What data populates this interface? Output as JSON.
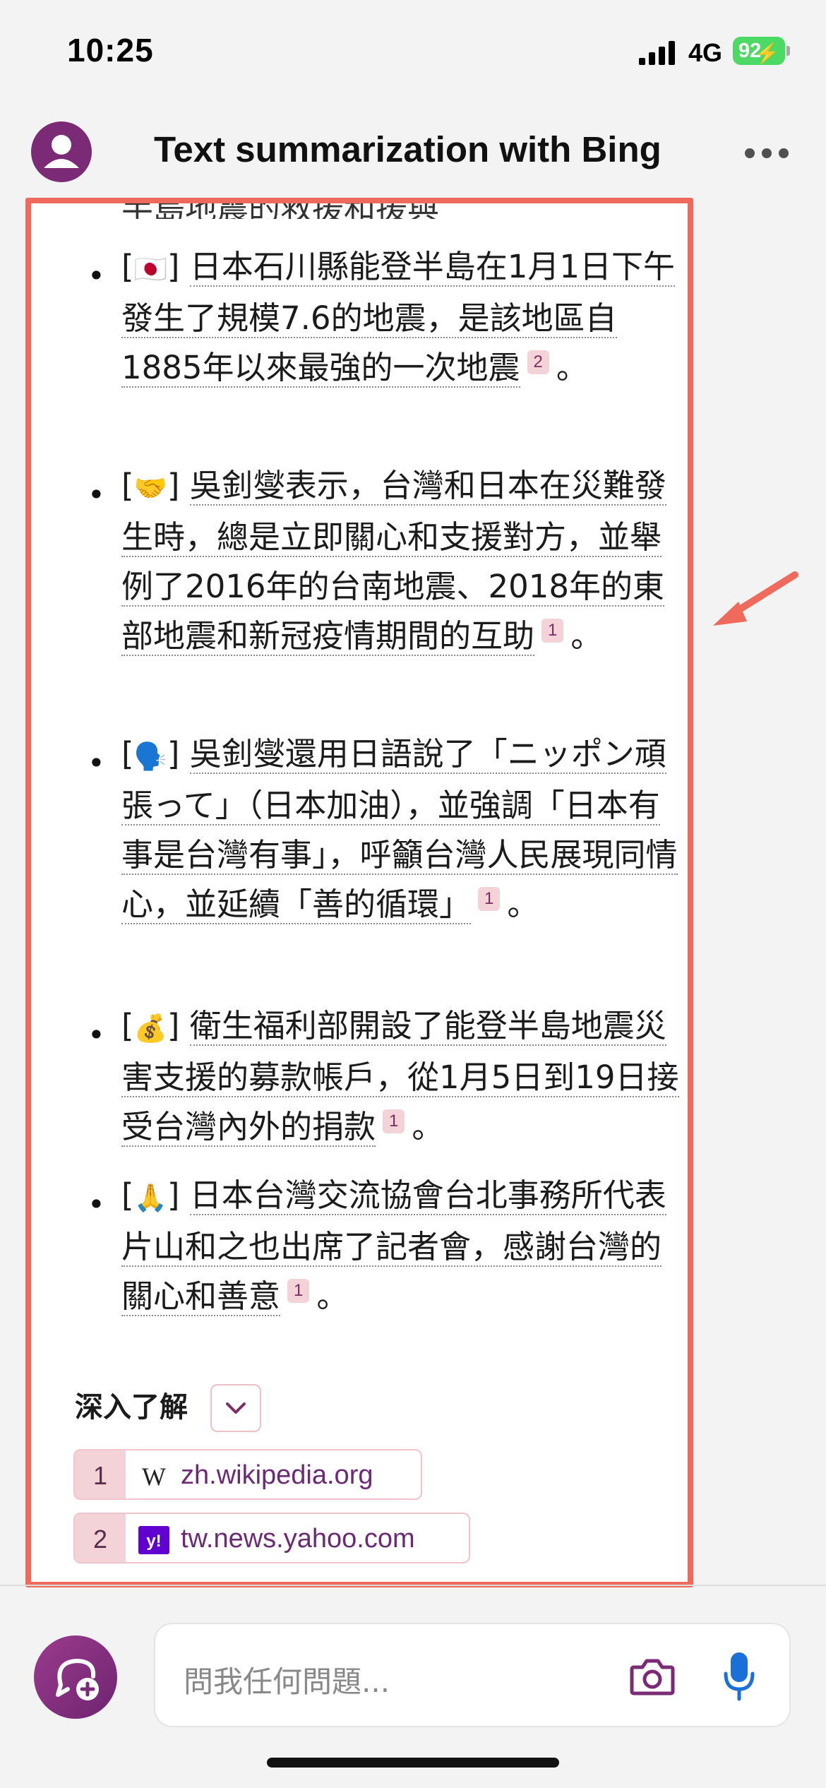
{
  "status_bar": {
    "time": "10:25",
    "network": "4G",
    "battery": "92"
  },
  "header": {
    "title": "Text summarization with Bing",
    "avatar_icon": "user-avatar-icon",
    "menu_icon": "more-horizontal-icon"
  },
  "response": {
    "cut_text": "半島地震的救援和援與",
    "items": [
      {
        "emoji": "🇯🇵",
        "text": "日本石川縣能登半島在1月1日下午發生了規模7.6的地震，是該地區自1885年以來最強的一次地震",
        "cite": "2",
        "end": "。"
      },
      {
        "emoji": "🤝",
        "text": "吳釗燮表示，台灣和日本在災難發生時，總是立即關心和支援對方，並舉例了2016年的台南地震、2018年的東部地震和新冠疫情期間的互助",
        "cite": "1",
        "end": "。"
      },
      {
        "emoji": "🗣️",
        "text": "吳釗燮還用日語說了「ニッポン頑張って」（日本加油），並強調「日本有事是台灣有事」，呼籲台灣人民展現同情心，並延續「善的循環」",
        "cite": "1",
        "end": "。"
      },
      {
        "emoji": "💰",
        "text": "衛生福利部開設了能登半島地震災害支援的募款帳戶，從1月5日到19日接受台灣內外的捐款",
        "cite": "1",
        "end": "。"
      },
      {
        "emoji": "🙏",
        "text": "日本台灣交流協會台北事務所代表片山和之也出席了記者會，感謝台灣的關心和善意",
        "cite": "1",
        "end": "。"
      }
    ],
    "learn_more_label": "深入了解",
    "sources": [
      {
        "num": "1",
        "icon": "wikipedia-icon",
        "domain": "zh.wikipedia.org"
      },
      {
        "num": "2",
        "icon": "yahoo-icon",
        "domain": "tw.news.yahoo.com"
      }
    ]
  },
  "input": {
    "placeholder": "問我任何問題..."
  },
  "colors": {
    "accent": "#7b2a75",
    "highlight_border": "#ef6a5c",
    "cite_bg": "#f3d3d8",
    "battery": "#4cd964",
    "mic": "#1a6fd8"
  }
}
